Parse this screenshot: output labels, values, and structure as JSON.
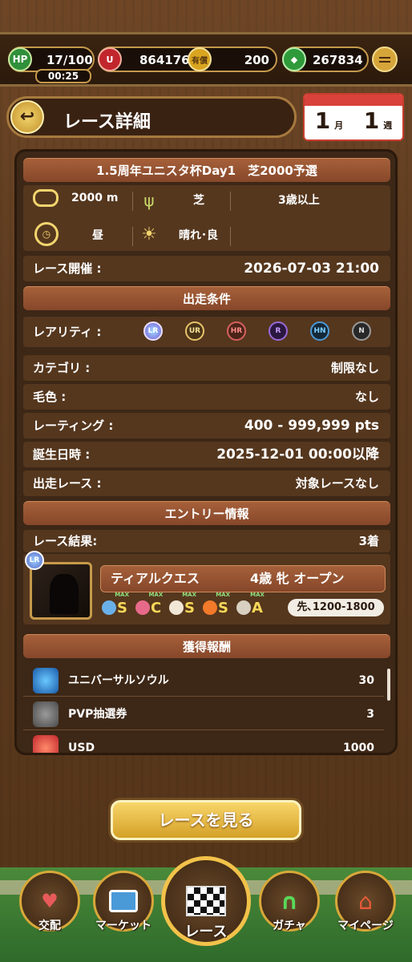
{
  "status": {
    "hp_icon_label": "HP",
    "hp": "17/100",
    "hp_timer": "00:25",
    "coins": "864176",
    "ticket_icon_label": "有償",
    "tickets": "200",
    "gems": "267834"
  },
  "header": {
    "title": "レース詳細",
    "calendar": {
      "month": "1",
      "month_unit": "月",
      "week": "1",
      "week_unit": "週"
    }
  },
  "race": {
    "name": "1.5周年ユニスタ杯Day1　芝2000予選",
    "distance": "2000 m",
    "surface": "芝",
    "age": "3歳以上",
    "time_of_day": "昼",
    "weather": "晴れ･良",
    "date_label": "レース開催 :",
    "date_value": "2026-07-03 21:00"
  },
  "conditions": {
    "title": "出走条件",
    "rarity_label": "レアリティ :",
    "rarities": [
      "LR",
      "UR",
      "HR",
      "R",
      "HN",
      "N"
    ],
    "category_label": "カテゴリ :",
    "category_value": "制限なし",
    "coat_label": "毛色 :",
    "coat_value": "なし",
    "rating_label": "レーティング :",
    "rating_value": "400 - 999,999 pts",
    "birth_label": "誕生日時 :",
    "birth_value": "2025-12-01 00:00以降",
    "race_label": "出走レース :",
    "race_value": "対象レースなし"
  },
  "entry": {
    "title": "エントリー情報",
    "result_label": "レース結果:",
    "result_value": "3着",
    "horse_rarity": "LR",
    "horse_name": "ティアルクエス",
    "horse_info": "4歳 牝 オープン",
    "max_label": "MAX",
    "stats": [
      "S",
      "C",
      "S",
      "S",
      "A"
    ],
    "style": "先､1200-1800"
  },
  "rewards": {
    "title": "獲得報酬",
    "items": [
      {
        "name": "ユニバーサルソウル",
        "qty": "30"
      },
      {
        "name": "PVP抽選券",
        "qty": "3"
      },
      {
        "name": "USD",
        "qty": "1000"
      }
    ]
  },
  "actions": {
    "watch_race": "レースを見る"
  },
  "nav": [
    {
      "label": "交配"
    },
    {
      "label": "マーケット"
    },
    {
      "label": "レース"
    },
    {
      "label": "ガチャ"
    },
    {
      "label": "マイページ"
    }
  ],
  "colors": {
    "section_header": "#9c5634",
    "row_bg": "#55371e",
    "gold": "#d8a83a",
    "grade": "#f7d75b"
  }
}
